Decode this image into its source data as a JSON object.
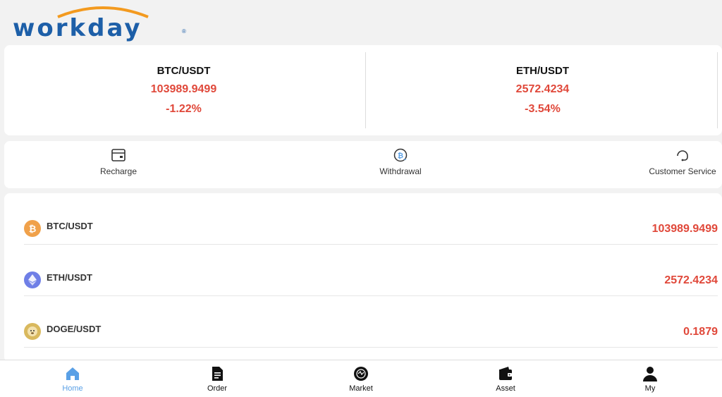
{
  "brand": {
    "logo_text": "workday",
    "logo_mark": "®"
  },
  "tickers": [
    {
      "pair": "BTC/USDT",
      "price": "103989.9499",
      "change": "-1.22%"
    },
    {
      "pair": "ETH/USDT",
      "price": "2572.4234",
      "change": "-3.54%"
    }
  ],
  "actions": [
    {
      "label": "Recharge",
      "icon": "wallet-card-icon"
    },
    {
      "label": "Withdrawal",
      "icon": "bitcoin-cycle-icon"
    },
    {
      "label": "Customer Service",
      "icon": "headset-icon"
    }
  ],
  "market_list": [
    {
      "pair": "BTC/USDT",
      "price": "103989.9499",
      "icon": "bitcoin-icon"
    },
    {
      "pair": "ETH/USDT",
      "price": "2572.4234",
      "icon": "ethereum-icon"
    },
    {
      "pair": "DOGE/USDT",
      "price": "0.1879",
      "icon": "dogecoin-icon"
    }
  ],
  "nav": [
    {
      "label": "Home",
      "icon": "home-icon",
      "active": true
    },
    {
      "label": "Order",
      "icon": "document-icon",
      "active": false
    },
    {
      "label": "Market",
      "icon": "market-icon",
      "active": false
    },
    {
      "label": "Asset",
      "icon": "wallet-icon",
      "active": false
    },
    {
      "label": "My",
      "icon": "user-icon",
      "active": false
    }
  ],
  "colors": {
    "accent_red": "#e0483a",
    "brand_blue": "#1d5fa8",
    "brand_orange": "#f39a1f",
    "nav_active": "#5aa0e6"
  }
}
